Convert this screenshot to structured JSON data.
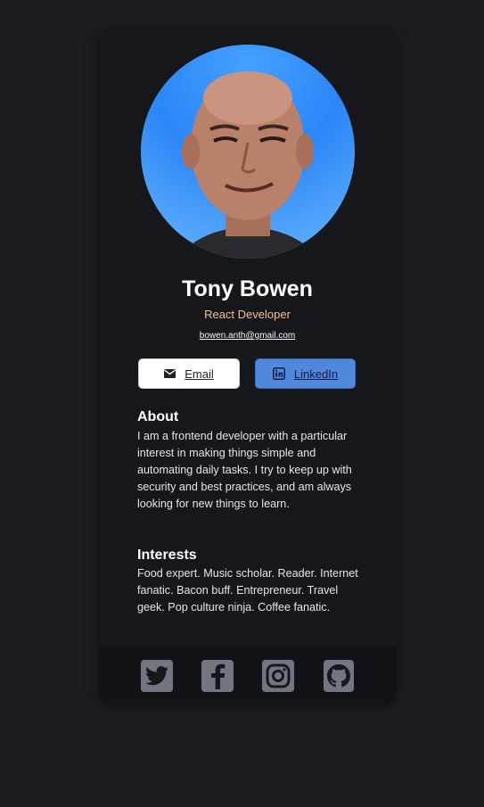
{
  "profile": {
    "name": "Tony Bowen",
    "title": "React Developer",
    "email": "bowen.anth@gmail.com"
  },
  "buttons": {
    "email_label": "Email",
    "linkedin_label": "LinkedIn"
  },
  "about": {
    "heading": "About",
    "text": "I am a frontend developer with a particular interest in making things simple and automating daily tasks. I try to keep up with security and best practices, and am always looking for new things to learn."
  },
  "interests": {
    "heading": "Interests",
    "text": "Food expert. Music scholar. Reader. Internet fanatic. Bacon buff. Entrepreneur. Travel geek. Pop culture ninja. Coffee fanatic."
  },
  "footer": {
    "icons": [
      "twitter-icon",
      "facebook-icon",
      "instagram-icon",
      "github-icon"
    ]
  },
  "colors": {
    "page_background": "#1b1d22",
    "card_background": "#16171a",
    "accent_role": "#f3bf99",
    "linkedin_button": "#5088dc",
    "social_icon": "#737580"
  }
}
